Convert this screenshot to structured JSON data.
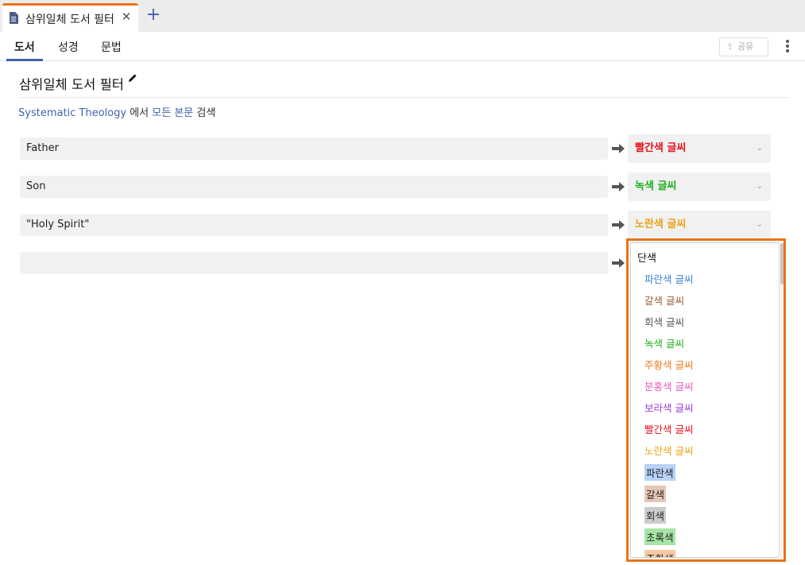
{
  "tab": {
    "title": "삼위일체 도서 필터",
    "close": "✕",
    "add": "+"
  },
  "nav": {
    "tabs": [
      {
        "label": "도서"
      },
      {
        "label": "성경"
      },
      {
        "label": "문법"
      }
    ],
    "share_label": "공유"
  },
  "page": {
    "title": "삼위일체 도서 필터",
    "desc_book": "Systematic Theology",
    "desc_in": "에서",
    "desc_scope": "모든 본문",
    "desc_search": "검색"
  },
  "rules": [
    {
      "term": "Father",
      "style": "빨간색 글씨",
      "color": "#e8101a"
    },
    {
      "term": "Son",
      "style": "녹색 글씨",
      "color": "#19b21b"
    },
    {
      "term": "\"Holy Spirit\"",
      "style": "노란색 글씨",
      "color": "#e8a312"
    },
    {
      "term": "",
      "style": "",
      "color": "#222222"
    }
  ],
  "dropdown": {
    "group": "단색",
    "items": [
      {
        "label": "파란색 글씨",
        "color": "#3f7fd8",
        "bg": ""
      },
      {
        "label": "갈색 글씨",
        "color": "#9a5a2e",
        "bg": ""
      },
      {
        "label": "회색 글씨",
        "color": "#555555",
        "bg": ""
      },
      {
        "label": "녹색 글씨",
        "color": "#19b21b",
        "bg": ""
      },
      {
        "label": "주황색 글씨",
        "color": "#ef7a1a",
        "bg": ""
      },
      {
        "label": "분홍색 글씨",
        "color": "#e55cbb",
        "bg": ""
      },
      {
        "label": "보라색 글씨",
        "color": "#9a3fd8",
        "bg": ""
      },
      {
        "label": "빨간색 글씨",
        "color": "#e8101a",
        "bg": ""
      },
      {
        "label": "노란색 글씨",
        "color": "#e8a312",
        "bg": ""
      },
      {
        "label": "파란색",
        "color": "#222222",
        "bg": "#b9d2f7"
      },
      {
        "label": "갈색",
        "color": "#222222",
        "bg": "#e5c7b6"
      },
      {
        "label": "회색",
        "color": "#222222",
        "bg": "#cccccc"
      },
      {
        "label": "초록색",
        "color": "#222222",
        "bg": "#a6e5a6"
      },
      {
        "label": "주황색",
        "color": "#222222",
        "bg": "#f8c9a2"
      }
    ]
  }
}
